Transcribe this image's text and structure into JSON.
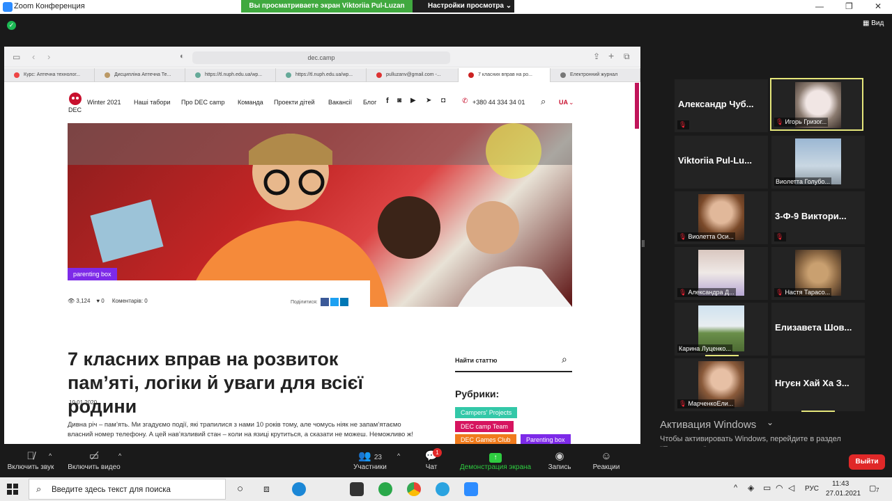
{
  "titlebar": {
    "app_title": "Zoom Конференция",
    "share_banner": "Вы просматриваете экран Viktoriia Pul-Luzan",
    "view_settings": "Настройки просмотра ⌄",
    "view_label": "Вид"
  },
  "browser": {
    "address": "dec.camp",
    "tabs": [
      "Курс: Аптечна технолог...",
      "Дисципліна Аптечна Те...",
      "https://tl.nuph.edu.ua/wp...",
      "https://tl.nuph.edu.ua/wp...",
      "pulluzanv@gmail.com -...",
      "7 класних вправ на ро...",
      "Електронний журнал"
    ]
  },
  "site": {
    "nav": [
      "Winter 2021",
      "Наші табори",
      "Про DEC camp",
      "Команда",
      "Проекти дітей",
      "Вакансії",
      "Блог"
    ],
    "phone": "+380 44 334 34 01",
    "lang": "UA",
    "badge": "parenting box",
    "views": "3,124",
    "likes": "0",
    "comments": "Коментарів: 0",
    "share_label": "Поділитися:",
    "title": "7 класних вправ на розвиток пам’яті, логіки й уваги для всієї родини",
    "date": "10.01.2020",
    "body": "Дивна річ – пам’ять. Ми згадуємо події, які трапилися з нами 10 років тому, але чомусь ніяк не запам’ятаємо власний номер телефону. А цей нав’язливий стан – коли на язиці крутиться, а сказати не можеш. Неможливо ж!",
    "search_label": "Найти статтю",
    "rubrics_title": "Рубрики:",
    "rubrics": [
      {
        "label": "Campers' Projects",
        "color": "#33c8a8"
      },
      {
        "label": "DEC camp Team",
        "color": "#d6145f"
      },
      {
        "label": "DEC Games Club",
        "color": "#f07b1c"
      },
      {
        "label": "Parenting box",
        "color": "#7d2ae8"
      }
    ]
  },
  "participants": [
    {
      "name": "Александр Чуб...",
      "photo": false,
      "muted": true
    },
    {
      "name": "Игорь Гризог...",
      "photo": true,
      "muted": true,
      "active": true
    },
    {
      "name": "Viktoriia Pul-Lu...",
      "photo": false,
      "muted": false
    },
    {
      "name": "Виолетта Голубо...",
      "photo": true,
      "muted": false
    },
    {
      "name": "Виолетта Оси...",
      "photo": true,
      "muted": true
    },
    {
      "name": "3-Ф-9 Виктори...",
      "photo": false,
      "muted": true
    },
    {
      "name": "Александра Д...",
      "photo": true,
      "muted": true
    },
    {
      "name": "Настя Тарасо...",
      "photo": true,
      "muted": true
    },
    {
      "name": "Карина Луценко...",
      "photo": true,
      "muted": false
    },
    {
      "name": "Елизавета Шов...",
      "photo": false,
      "muted": false
    },
    {
      "name": "МарченкоЕли...",
      "photo": true,
      "muted": true
    },
    {
      "name": "Нгуєн Хай Ха З...",
      "photo": false,
      "muted": false
    }
  ],
  "windows_activation": {
    "title": "Активация Windows",
    "text": "Чтобы активировать Windows, перейдите в раздел \"Параметры\"."
  },
  "controls": {
    "mute": "Включить звук",
    "video": "Включить видео",
    "participants": "Участники",
    "participants_count": "23",
    "chat": "Чат",
    "chat_badge": "1",
    "share": "Демонстрация экрана",
    "record": "Запись",
    "reactions": "Реакции",
    "leave": "Выйти"
  },
  "taskbar": {
    "search_placeholder": "Введите здесь текст для поиска",
    "lang": "РУС",
    "time": "11:43",
    "date": "27.01.2021",
    "notif_count": "7"
  }
}
